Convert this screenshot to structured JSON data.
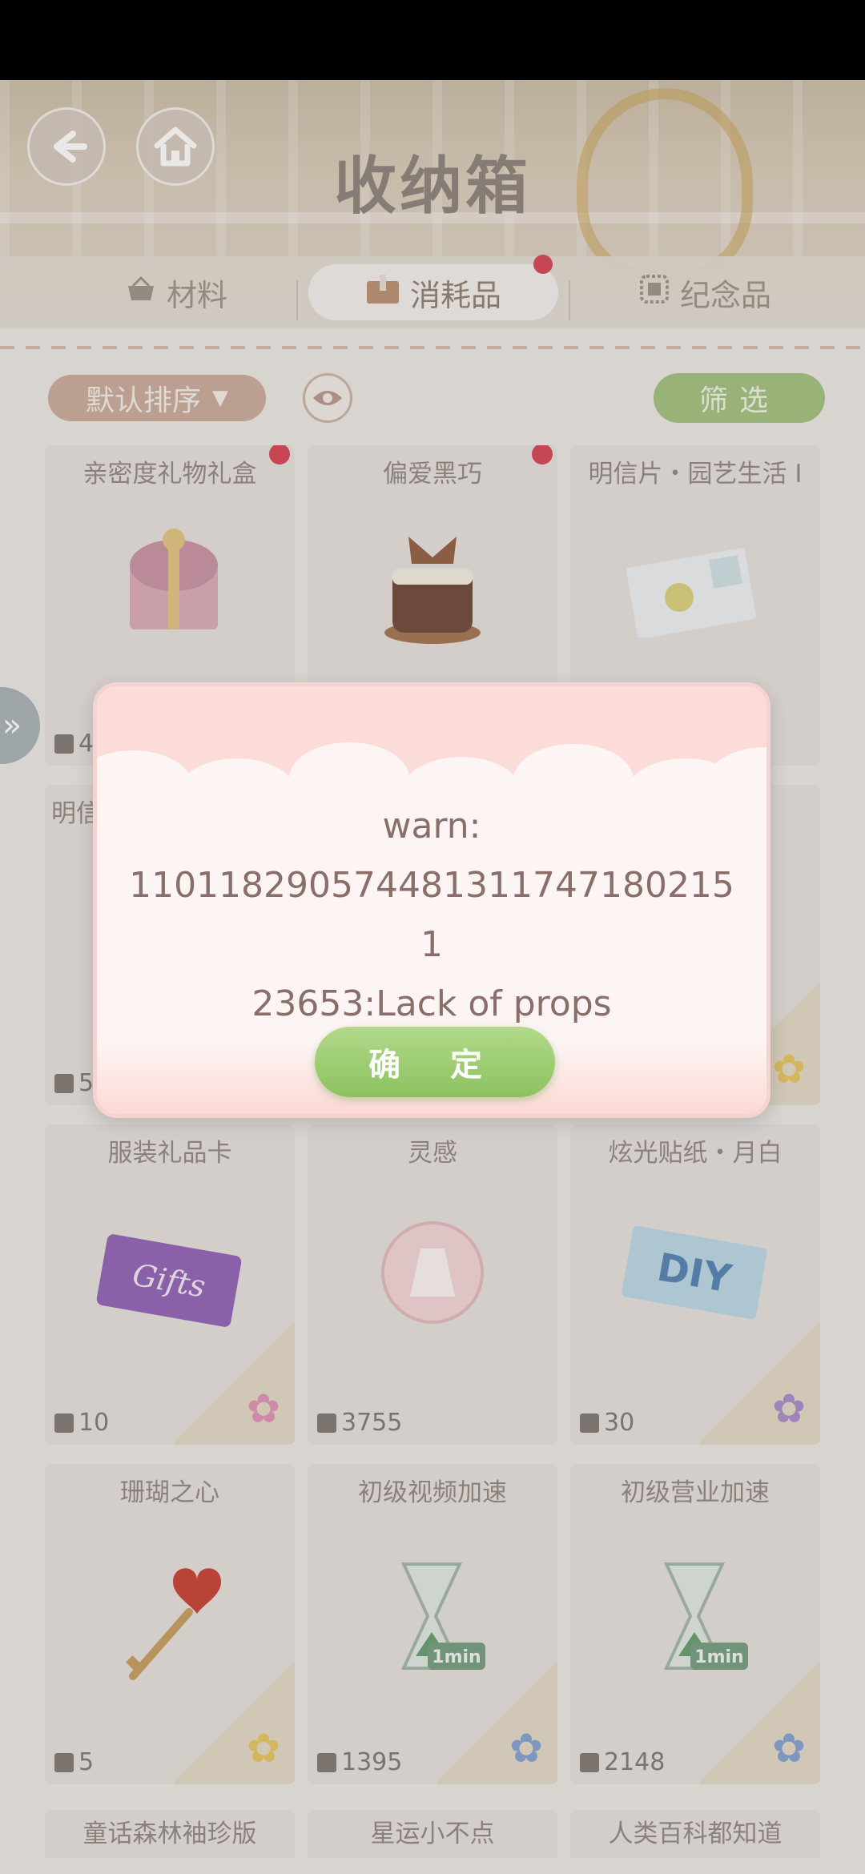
{
  "header": {
    "title": "收纳箱"
  },
  "tabs": [
    {
      "label": "材料"
    },
    {
      "label": "消耗品"
    },
    {
      "label": "纪念品"
    }
  ],
  "toolbar": {
    "sort_label": "默认排序",
    "filter_label": "筛选"
  },
  "items": [
    {
      "name": "亲密度礼物礼盒",
      "count": "4",
      "new": true
    },
    {
      "name": "偏爱黑巧",
      "count": "",
      "new": true
    },
    {
      "name": "明信片・园艺生活 I",
      "count": "",
      "new": false
    },
    {
      "name": "明信",
      "count": "5",
      "new": false
    },
    {
      "name": "服装礼品卡",
      "count": "10",
      "new": false
    },
    {
      "name": "灵感",
      "count": "3755",
      "new": false
    },
    {
      "name": "炫光贴纸・月白",
      "count": "30",
      "new": false
    },
    {
      "name": "珊瑚之心",
      "count": "5",
      "new": false
    },
    {
      "name": "初级视频加速",
      "count": "1395",
      "new": false
    },
    {
      "name": "初级营业加速",
      "count": "2148",
      "new": false
    },
    {
      "name": "童话森林袖珍版"
    },
    {
      "name": "星运小不点"
    },
    {
      "name": "人类百科都知道"
    }
  ],
  "item_art": {
    "gift_card": "Gifts",
    "sticker": "DIY",
    "speedup": "1min"
  },
  "dialog": {
    "line1": "warn:",
    "line2": "110118290574481311747180215 1",
    "line3": "23653:Lack of props",
    "confirm_label": "确 定"
  },
  "colors": {
    "accent_green": "#8cc260",
    "badge_red": "#d5404f",
    "sort_brown": "#c9a898"
  }
}
